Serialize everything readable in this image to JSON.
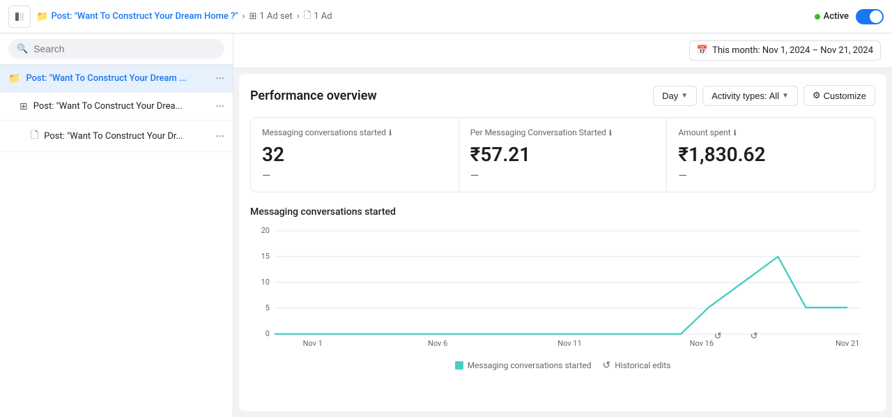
{
  "topbar": {
    "toggle_icon": "☰",
    "campaign_label": "Post: \"Want To Construct Your Dream Home ?\"",
    "adset_label": "1 Ad set",
    "ad_label": "1 Ad",
    "active_label": "Active",
    "date_range": "This month: Nov 1, 2024 – Nov 21, 2024"
  },
  "sidebar": {
    "search_placeholder": "Search",
    "items": [
      {
        "id": "campaign",
        "label": "Post: \"Want To Construct Your Dream ...",
        "type": "campaign",
        "active": true
      },
      {
        "id": "adset",
        "label": "Post: \"Want To Construct Your Drea...",
        "type": "adset",
        "active": false
      },
      {
        "id": "ad",
        "label": "Post: \"Want To Construct Your Dr...",
        "type": "ad",
        "active": false
      }
    ]
  },
  "performance": {
    "title": "Performance overview",
    "controls": {
      "day_label": "Day",
      "activity_label": "Activity types: All",
      "customize_label": "Customize"
    },
    "metrics": [
      {
        "label": "Messaging conversations started",
        "value": "32",
        "sub": "—"
      },
      {
        "label": "Per Messaging Conversation Started",
        "value": "₹57.21",
        "sub": "—"
      },
      {
        "label": "Amount spent",
        "value": "₹1,830.62",
        "sub": "—"
      }
    ],
    "chart": {
      "title": "Messaging conversations started",
      "y_labels": [
        "20",
        "15",
        "10",
        "5",
        "0"
      ],
      "x_labels": [
        "Nov 1",
        "Nov 6",
        "Nov 11",
        "Nov 16",
        "Nov 21"
      ],
      "legend": [
        {
          "type": "color",
          "color": "#4ecdc4",
          "label": "Messaging conversations started"
        },
        {
          "type": "icon",
          "label": "Historical edits"
        }
      ]
    }
  }
}
